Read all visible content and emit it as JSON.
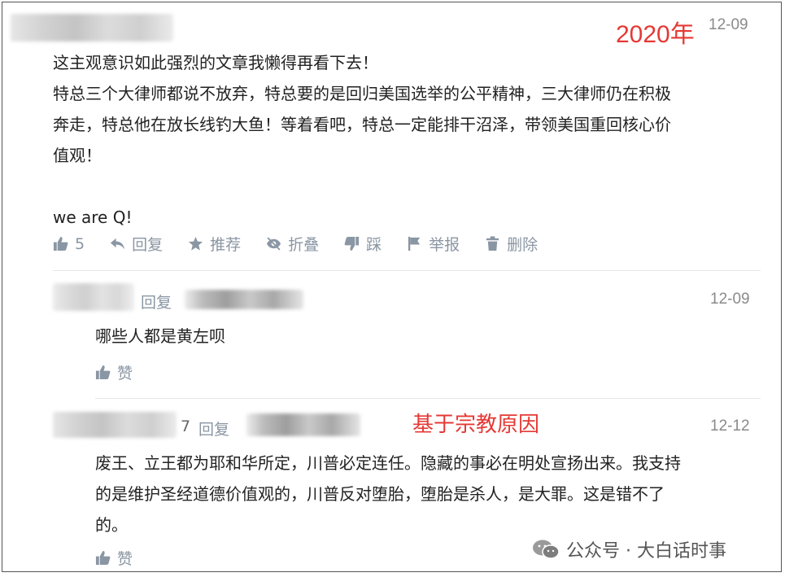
{
  "top_comment": {
    "annotation_year": "2020年",
    "date": "12-09",
    "text": "这主观意识如此强烈的文章我懒得再看下去！\n特总三个大律师都说不放弃，特总要的是回归美国选举的公平精神，三大律师仍在积极\n奔走，特总他在放长线钓大鱼！等着看吧，特总一定能排干沼泽，带领美国重回核心价\n值观！\n\nwe are Q!",
    "actions": {
      "like_count": "5",
      "reply": "回复",
      "recommend": "推荐",
      "fold": "折叠",
      "dislike": "踩",
      "report": "举报",
      "delete": "删除"
    }
  },
  "replies": [
    {
      "reply_label": "回复",
      "date": "12-09",
      "text": "哪些人都是黄左呗",
      "like_label": "赞"
    },
    {
      "partial_name_char": "7",
      "reply_label": "回复",
      "annotation": "基于宗教原因",
      "date": "12-12",
      "text": "废王、立王都为耶和华所定，川普必定连任。隐藏的事必在明处宣扬出来。我支持\n的是维护圣经道德价值观的，川普反对堕胎，堕胎是杀人，是大罪。这是错不了\n的。",
      "like_label": "赞"
    }
  ],
  "watermark": {
    "text": "公众号 · 大白话时事"
  },
  "colors": {
    "annotation_red": "#e53935",
    "meta_gray": "#8a96a3",
    "text": "#222222"
  }
}
